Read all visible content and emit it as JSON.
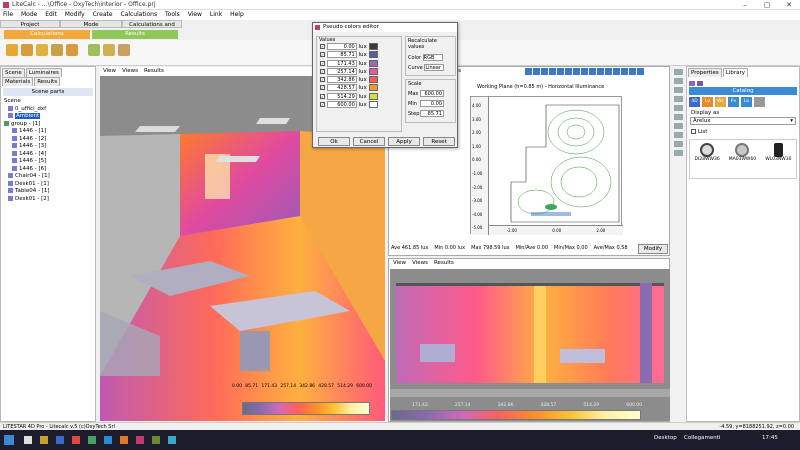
{
  "window": {
    "title": "LiteCalc - ...\\Office - OxyTech\\interior - Office.prj"
  },
  "menu": [
    "File",
    "Mode",
    "Edit",
    "Modify",
    "Create",
    "Calculations",
    "Tools",
    "View",
    "Link",
    "Help"
  ],
  "mode_tabs": [
    "Project",
    "Mode",
    "Calculations and Results"
  ],
  "mode_buttons": {
    "calculations": "Calculations",
    "results": "Results"
  },
  "left_panel": {
    "tabs": [
      "Scene",
      "Luminaires",
      "Materials",
      "Results"
    ],
    "header": "Scene parts",
    "tree": [
      "Scene",
      "0_uffici_dxf",
      "Ambient",
      "group - [1]",
      "1446 - [1]",
      "1446 - [2]",
      "1446 - [3]",
      "1446 - [4]",
      "1446 - [5]",
      "1446 - [6]",
      "Chair04 - [1]",
      "Desk01 - [1]",
      "Table04 - [1]",
      "Desk01 - [2]"
    ]
  },
  "view3d": {
    "tabs": [
      "View",
      "Views",
      "Results"
    ],
    "scale_ticks": [
      "0.00",
      "85.71",
      "171.43",
      "257.14",
      "342.86",
      "428.57",
      "514.29",
      "600.00"
    ]
  },
  "dialog": {
    "title": "Pseudo colors editor",
    "values_label": "Values",
    "unit": "lux",
    "values": [
      {
        "value": "0.00",
        "color": "#3a3a3a"
      },
      {
        "value": "85.71",
        "color": "#5a5aa8"
      },
      {
        "value": "171.43",
        "color": "#9a6ab8"
      },
      {
        "value": "257.14",
        "color": "#e05aa8"
      },
      {
        "value": "342.86",
        "color": "#ff5a5a"
      },
      {
        "value": "428.57",
        "color": "#ff9a1a"
      },
      {
        "value": "514.29",
        "color": "#d8e040"
      },
      {
        "value": "600.00",
        "color": "#ffffff"
      }
    ],
    "recalc_label": "Recalculate values",
    "color_label": "Color",
    "color_value": "RGB",
    "curve_label": "Curve",
    "curve_value": "Linear",
    "scale_label": "Scale",
    "max_label": "Max",
    "max_value": "600.00",
    "min_label": "Min",
    "min_value": "0.00",
    "step_label": "Step",
    "step_value": "85.71",
    "buttons": {
      "ok": "Ok",
      "cancel": "Cancel",
      "apply": "Apply",
      "reset": "Reset"
    }
  },
  "plan_view": {
    "results_tab": "ults",
    "title": "Working Plane (h=0.85 m) - Horizontal Illuminance",
    "y_ticks": [
      "4.00",
      "3.00",
      "2.00",
      "1.00",
      "0.00",
      "-1.00",
      "-2.00",
      "-3.00",
      "-4.00",
      "-5.00"
    ],
    "x_ticks": [
      "-2.00",
      "0.00",
      "2.00"
    ],
    "stats": {
      "ave": "Ave  461.85  lux",
      "min": "Min  0.00  lux",
      "max": "Max  798.59  lux",
      "min_ave": "Min/Ave  0.00",
      "min_max": "Min/Max  0.00",
      "ave_max": "Ave/Max  0.58"
    },
    "modify_button": "Modify"
  },
  "bottom_view": {
    "tabs": [
      "View",
      "Views",
      "Results"
    ],
    "scale_ticks": [
      "171.43",
      "257.14",
      "342.86",
      "428.57",
      "514.29",
      "600.00"
    ]
  },
  "right_panel": {
    "tabs": [
      "Properties",
      "Library"
    ],
    "catalog_label": "Catalog",
    "tool_labels": [
      "4D",
      "Lv",
      "Ws",
      "Pv",
      "Lo"
    ],
    "display_as_label": "Display as",
    "display_as_value": "Arelux",
    "list_label": "List",
    "items": [
      "DI28WW36",
      "MA03WW60",
      "WL03NW30"
    ]
  },
  "status": {
    "left": "LITESTAR 4D Pro - Litecalc v.5    (c)OxyTech Srl",
    "right": "-4.59, y=8188251.92, z=0.00"
  },
  "taskbar": {
    "desktop": "Desktop",
    "links": "Collegamenti",
    "time": "17:45"
  },
  "colors": {
    "calc": "#f2a93b",
    "results": "#8fc75a",
    "accent": "#c03a6b"
  }
}
